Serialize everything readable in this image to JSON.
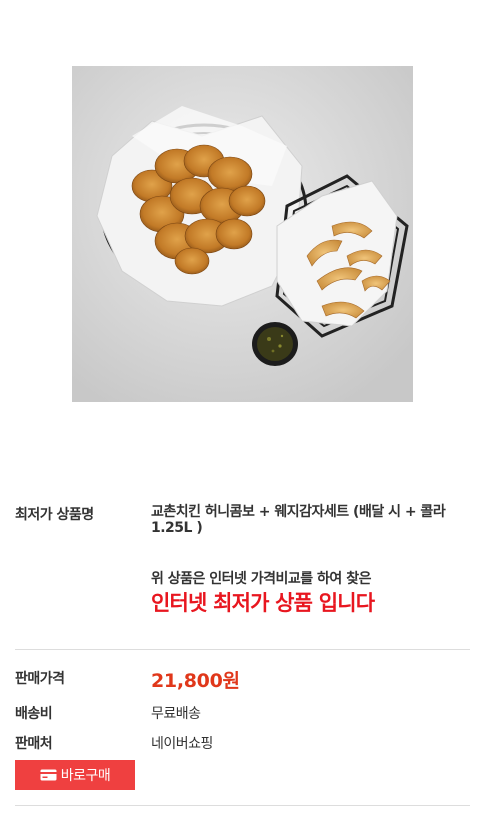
{
  "product": {
    "image_icon": "fried-chicken-and-potato-wedges-photo",
    "lowest_price_label": "최저가 상품명",
    "name": "교촌치킨 허니콤보 + 웨지감자세트 (배달 시 + 콜라1.25L )",
    "notice_line": "위 상품은 인터넷 가격비교를 하여 찾은",
    "notice_strong": "인터넷 최저가 상품 입니다"
  },
  "details": {
    "price_label": "판매가격",
    "price_value": "21,800원",
    "shipping_label": "배송비",
    "shipping_value": "무료배송",
    "seller_label": "판매처",
    "seller_value": "네이버쇼핑"
  },
  "actions": {
    "buy_label": "바로구매",
    "buy_icon": "credit-card-icon"
  },
  "colors": {
    "accent_red": "#e8161f",
    "price_red": "#e0371a",
    "button_red": "#ef4040",
    "divider": "#dddddd"
  }
}
